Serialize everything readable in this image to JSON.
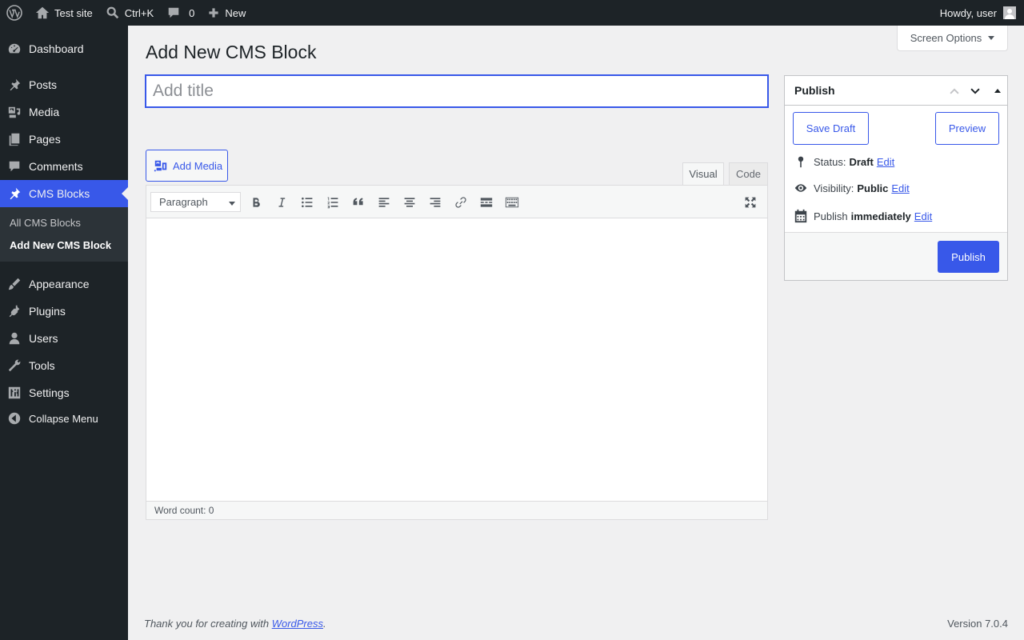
{
  "adminbar": {
    "site_name": "Test site",
    "search_shortcut": "Ctrl+K",
    "comments_count": "0",
    "new_label": "New",
    "greeting": "Howdy, user"
  },
  "sidebar": {
    "items": [
      {
        "label": "Dashboard",
        "icon": "dashboard-icon"
      },
      {
        "label": "Posts",
        "icon": "pin-icon"
      },
      {
        "label": "Media",
        "icon": "media-icon"
      },
      {
        "label": "Pages",
        "icon": "pages-icon"
      },
      {
        "label": "Comments",
        "icon": "comments-icon"
      },
      {
        "label": "CMS Blocks",
        "icon": "pin-icon",
        "active": true
      },
      {
        "label": "Appearance",
        "icon": "brush-icon"
      },
      {
        "label": "Plugins",
        "icon": "plugin-icon"
      },
      {
        "label": "Users",
        "icon": "users-icon"
      },
      {
        "label": "Tools",
        "icon": "wrench-icon"
      },
      {
        "label": "Settings",
        "icon": "settings-icon"
      }
    ],
    "submenu": [
      "All CMS Blocks",
      "Add New CMS Block"
    ],
    "collapse_label": "Collapse Menu"
  },
  "main": {
    "page_title": "Add New CMS Block",
    "screen_options_label": "Screen Options",
    "title_placeholder": "Add title",
    "add_media_label": "Add Media",
    "tabs": {
      "visual": "Visual",
      "code": "Code"
    },
    "format_select_value": "Paragraph",
    "word_count": "Word count: 0"
  },
  "publish": {
    "header": "Publish",
    "save_draft_label": "Save Draft",
    "preview_label": "Preview",
    "status_label": "Status:",
    "status_value": "Draft",
    "visibility_label": "Visibility:",
    "visibility_value": "Public",
    "schedule_label": "Publish",
    "schedule_value": "immediately",
    "edit_label": "Edit",
    "publish_button_label": "Publish"
  },
  "footer": {
    "thanks_prefix": "Thank you for creating with ",
    "thanks_link": "WordPress",
    "thanks_suffix": ".",
    "version": "Version 7.0.4"
  },
  "colors": {
    "accent": "#3858e9",
    "adminbar_bg": "#1d2327",
    "page_bg": "#f0f0f1"
  }
}
